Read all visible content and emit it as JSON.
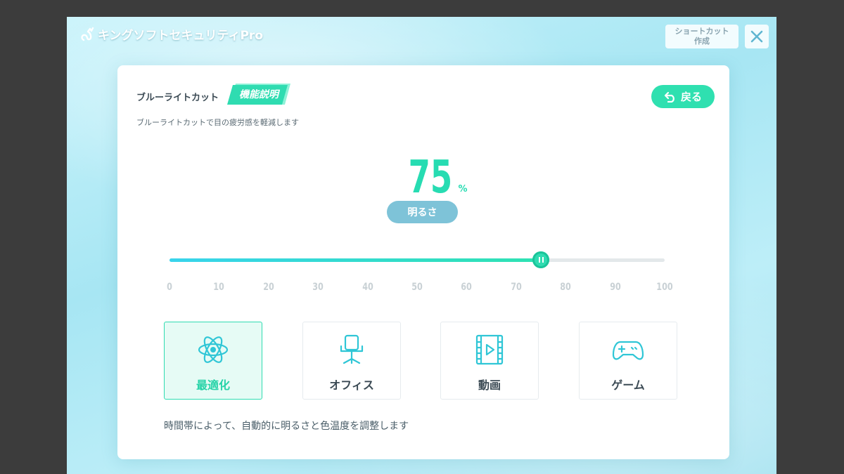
{
  "app": {
    "title": "キングソフトセキュリティPro",
    "shortcut_line1": "ショートカット",
    "shortcut_line2": "作成"
  },
  "panel": {
    "title": "ブルーライトカット",
    "feature_button": "機能説明",
    "description": "ブルーライトカットで目の疲労感を軽減します",
    "back_label": "戻る"
  },
  "level": {
    "value": "75",
    "unit": "%",
    "mode_label": "明るさ"
  },
  "slider": {
    "min": 0,
    "max": 100,
    "value": 75,
    "ticks": [
      "0",
      "10",
      "20",
      "30",
      "40",
      "50",
      "60",
      "70",
      "80",
      "90",
      "100"
    ]
  },
  "modes": [
    {
      "label": "最適化",
      "icon": "atom-icon",
      "active": true
    },
    {
      "label": "オフィス",
      "icon": "office-chair-icon",
      "active": false
    },
    {
      "label": "動画",
      "icon": "video-icon",
      "active": false
    },
    {
      "label": "ゲーム",
      "icon": "gamepad-icon",
      "active": false
    }
  ],
  "mode_description": "時間帯によって、自動的に明るさと色温度を調整します",
  "colors": {
    "accent": "#2fdcb1",
    "slider_start": "#39d4ec",
    "badge": "#7ec3d8"
  }
}
